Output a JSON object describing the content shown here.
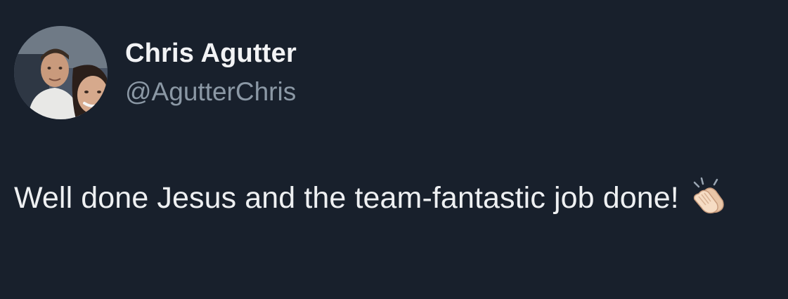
{
  "tweet": {
    "author": {
      "display_name": "Chris Agutter",
      "handle": "@AgutterChris",
      "avatar_icon": "profile-photo"
    },
    "text": "Well done Jesus and the team-fantastic job done!",
    "emoji": {
      "icon": "clapping-hands-icon",
      "char": "👏🏻"
    }
  },
  "colors": {
    "background": "#18202c",
    "name": "#f2f3f5",
    "handle": "#8b98a5",
    "text": "#eef0f2"
  }
}
